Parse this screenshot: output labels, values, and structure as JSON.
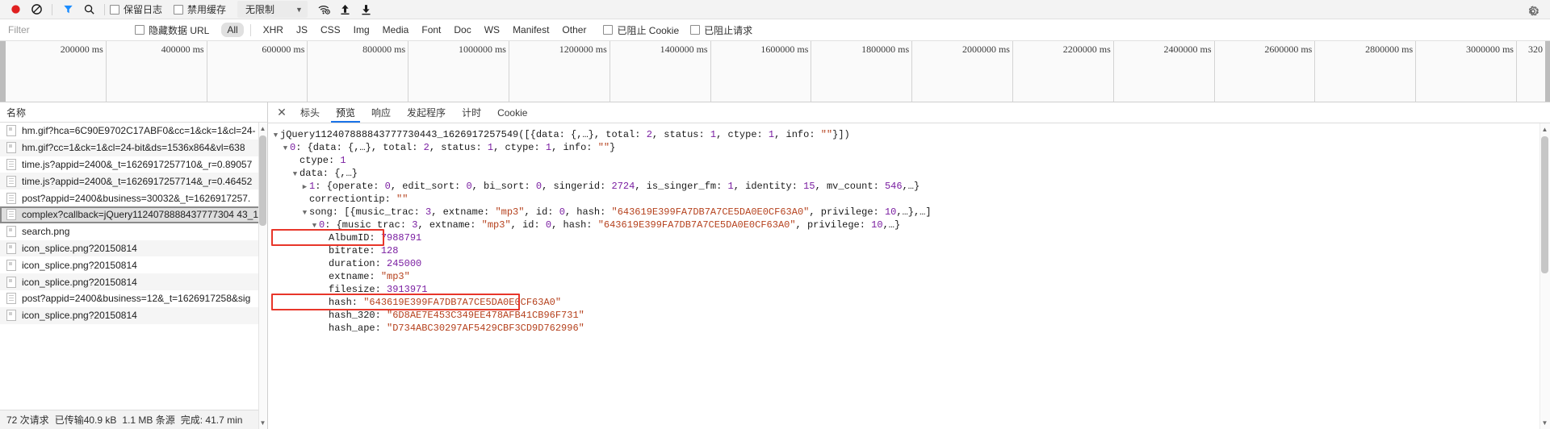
{
  "toolbar": {
    "record_icon": "record-circle-icon",
    "clear_icon": "clear-no-entry-icon",
    "filter_icon": "funnel-filter-icon",
    "search_icon": "search-magnifier-icon",
    "preserve_log": {
      "label": "保留日志",
      "checked": false
    },
    "disable_cache": {
      "label": "禁用缓存",
      "checked": false
    },
    "throttle": {
      "value": "无限制",
      "caret": "▼"
    },
    "wifi_icon": "wifi-settings-icon",
    "upload_icon": "upload-arrow-icon",
    "download_icon": "download-arrow-icon",
    "settings_icon": "gear-settings-icon"
  },
  "filterbar": {
    "placeholder": "Filter",
    "value": "",
    "hide_data_urls": {
      "label": "隐藏数据 URL",
      "checked": false
    },
    "types": [
      "All",
      "XHR",
      "JS",
      "CSS",
      "Img",
      "Media",
      "Font",
      "Doc",
      "WS",
      "Manifest",
      "Other"
    ],
    "active_type": "All",
    "blocked_cookies": {
      "label": "已阻止 Cookie",
      "checked": false
    },
    "blocked_requests": {
      "label": "已阻止请求",
      "checked": false
    }
  },
  "overview": {
    "ticks": [
      "200000 ms",
      "400000 ms",
      "600000 ms",
      "800000 ms",
      "1000000 ms",
      "1200000 ms",
      "1400000 ms",
      "1600000 ms",
      "1800000 ms",
      "2000000 ms",
      "2200000 ms",
      "2400000 ms",
      "2600000 ms",
      "2800000 ms",
      "3000000 ms",
      "320"
    ]
  },
  "requests": {
    "column_header": "名称",
    "rows": [
      {
        "name": "hm.gif?hca=6C90E9702C17ABF0&cc=1&ck=1&cl=24-",
        "icon": "image-file-icon",
        "selected": false
      },
      {
        "name": "hm.gif?cc=1&ck=1&cl=24-bit&ds=1536x864&vl=638",
        "icon": "image-file-icon",
        "selected": false
      },
      {
        "name": "time.js?appid=2400&_t=1626917257710&_r=0.89057",
        "icon": "script-file-icon",
        "selected": false
      },
      {
        "name": "time.js?appid=2400&_t=1626917257714&_r=0.46452",
        "icon": "script-file-icon",
        "selected": false
      },
      {
        "name": "post?appid=2400&business=30032&_t=1626917257.",
        "icon": "script-file-icon",
        "selected": false
      },
      {
        "name": "complex?callback=jQuery1124078888437777304 43_1.",
        "icon": "script-file-icon",
        "selected": true
      },
      {
        "name": "search.png",
        "icon": "image-file-icon",
        "selected": false
      },
      {
        "name": "icon_splice.png?20150814",
        "icon": "image-file-icon",
        "selected": false
      },
      {
        "name": "icon_splice.png?20150814",
        "icon": "image-file-icon",
        "selected": false
      },
      {
        "name": "icon_splice.png?20150814",
        "icon": "image-file-icon",
        "selected": false
      },
      {
        "name": "post?appid=2400&business=12&_t=1626917258&sig",
        "icon": "script-file-icon",
        "selected": false
      },
      {
        "name": "icon_splice.png?20150814",
        "icon": "image-file-icon",
        "selected": false
      }
    ]
  },
  "statusbar": {
    "requests": "72 次请求",
    "transferred": "已传输40.9 kB",
    "resources": "1.1 MB 条源",
    "finish": "完成: 41.7 min"
  },
  "detail": {
    "close_icon": "close-x-icon",
    "tabs": [
      "标头",
      "预览",
      "响应",
      "发起程序",
      "计时",
      "Cookie"
    ],
    "active_tab": "预览",
    "preview_lines": [
      {
        "indent": 0,
        "tri": "▼",
        "text": "jQuery112407888843777730443_1626917257549([{data: {,…}, total: 2, status: 1, ctype: 1, info: \"\"}])"
      },
      {
        "indent": 1,
        "tri": "▼",
        "text": "0: {data: {,…}, total: 2, status: 1, ctype: 1, info: \"\"}"
      },
      {
        "indent": 2,
        "tri": "",
        "text": "ctype: 1"
      },
      {
        "indent": 2,
        "tri": "▼",
        "text": "data: {,…}"
      },
      {
        "indent": 3,
        "tri": "▶",
        "text": "1: {operate: 0, edit_sort: 0, bi_sort: 0, singerid: 2724, is_singer_fm: 1, identity: 15, mv_count: 546,…}"
      },
      {
        "indent": 3,
        "tri": "",
        "text": "correctiontip: \"\""
      },
      {
        "indent": 3,
        "tri": "▼",
        "text": "song: [{music_trac: 3, extname: \"mp3\", id: 0, hash: \"643619E399FA7DB7A7CE5DA0E0CF63A0\", privilege: 10,…},…]"
      },
      {
        "indent": 4,
        "tri": "▼",
        "text": "0: {music trac: 3, extname: \"mp3\", id: 0, hash: \"643619E399FA7DB7A7CE5DA0E0CF63A0\", privilege: 10,…}"
      },
      {
        "indent": 5,
        "tri": "",
        "text": "AlbumID: 7988791"
      },
      {
        "indent": 5,
        "tri": "",
        "text": "bitrate: 128"
      },
      {
        "indent": 5,
        "tri": "",
        "text": "duration: 245000"
      },
      {
        "indent": 5,
        "tri": "",
        "text": "extname: \"mp3\""
      },
      {
        "indent": 5,
        "tri": "",
        "text": "filesize: 3913971"
      },
      {
        "indent": 5,
        "tri": "",
        "text": "hash: \"643619E399FA7DB7A7CE5DA0E0CF63A0\""
      },
      {
        "indent": 5,
        "tri": "",
        "text": "hash_320: \"6D8AE7E453C349EE478AFB41CB96F731\""
      },
      {
        "indent": 5,
        "tri": "",
        "text": "hash_ape: \"D734ABC30297AF5429CBF3CD9D762996\""
      }
    ],
    "annotations": [
      {
        "name": "albumid-highlight",
        "label": "AlbumID: 7988791"
      },
      {
        "name": "hash-highlight",
        "label": "hash: \"643619E399FA7DB7A7CE5DA0E0CF63A0\""
      }
    ]
  },
  "colors": {
    "accent": "#1a73e8",
    "annotation": "#e8362a",
    "record": "#e02020",
    "filter_active": "#1a8cff"
  }
}
